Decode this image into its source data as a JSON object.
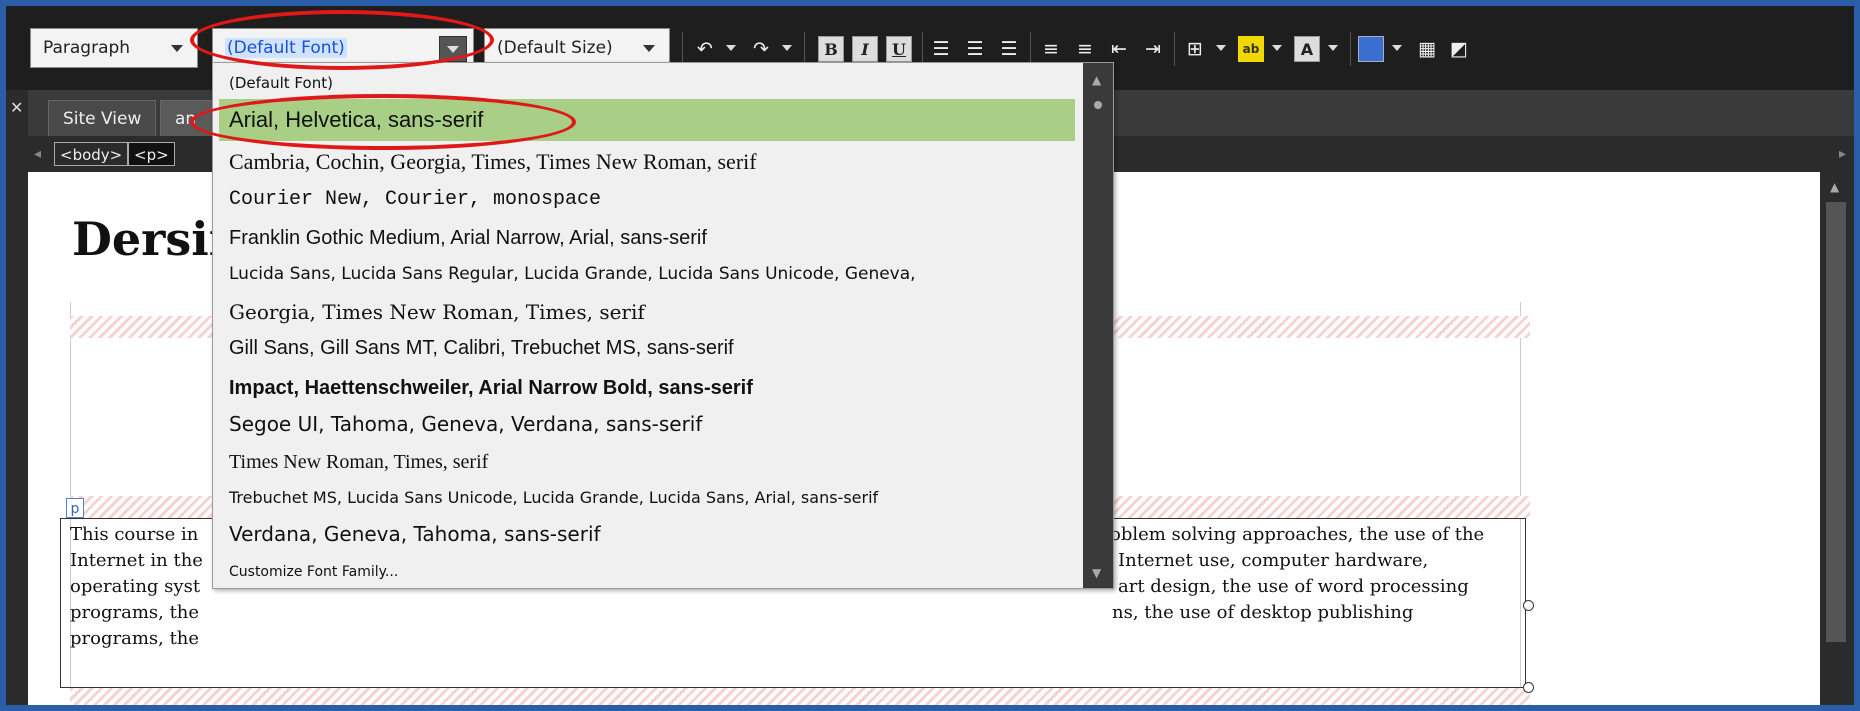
{
  "toolbar": {
    "format_select": "Paragraph",
    "font_select": "(Default Font)",
    "size_select": "(Default Size)",
    "icons": [
      "undo-icon",
      "redo-icon",
      "bold-icon",
      "italic-icon",
      "underline-icon",
      "align-left-icon",
      "align-center-icon",
      "align-right-icon",
      "ordered-list-icon",
      "unordered-list-icon",
      "outdent-icon",
      "indent-icon",
      "table-icon",
      "highlight-icon",
      "font-color-icon",
      "insert-table-icon",
      "layout-icon"
    ],
    "bold_label": "B",
    "italic_label": "I",
    "underline_label": "U",
    "highlight_label": "ab",
    "font_color_label": "A"
  },
  "tabs": [
    {
      "label": "Site View"
    },
    {
      "label": "an"
    }
  ],
  "breadcrumb": [
    "<body>",
    "<p>"
  ],
  "document": {
    "heading": "Dersin",
    "p_marker": "p",
    "left_lines": [
      "This course in",
      "Internet in the",
      "operating syst",
      "programs, the",
      "programs, the"
    ],
    "right_lines": [
      "oblem solving approaches, the use of the",
      "Internet use, computer hardware,",
      "art design, the use of word processing",
      "ns, the use of desktop publishing"
    ]
  },
  "font_dropdown": {
    "options": [
      "(Default Font)",
      "Arial,  Helvetica,  sans-serif",
      "Cambria,  Cochin,  Georgia,  Times,  Times New Roman,  serif",
      "Courier New,  Courier,  monospace",
      "Franklin Gothic Medium,  Arial Narrow,  Arial,  sans-serif",
      "Lucida Sans,  Lucida Sans Regular,  Lucida Grande,  Lucida Sans Unicode,  Geneva,",
      "Georgia,  Times New Roman,  Times,  serif",
      "Gill Sans,  Gill Sans MT,  Calibri,  Trebuchet MS,  sans-serif",
      "Impact,  Haettenschweiler,  Arial Narrow Bold,  sans-serif",
      "Segoe UI,  Tahoma,  Geneva,  Verdana,  sans-serif",
      "Times New Roman,  Times,  serif",
      "Trebuchet MS,  Lucida Sans Unicode,  Lucida Grande,  Lucida Sans,  Arial,  sans-serif",
      "Verdana,  Geneva,  Tahoma,  sans-serif",
      "Customize Font Family..."
    ],
    "highlighted_index": 1,
    "highlight_color": "#a8cf85"
  },
  "annotations": {
    "color": "#e01818"
  }
}
